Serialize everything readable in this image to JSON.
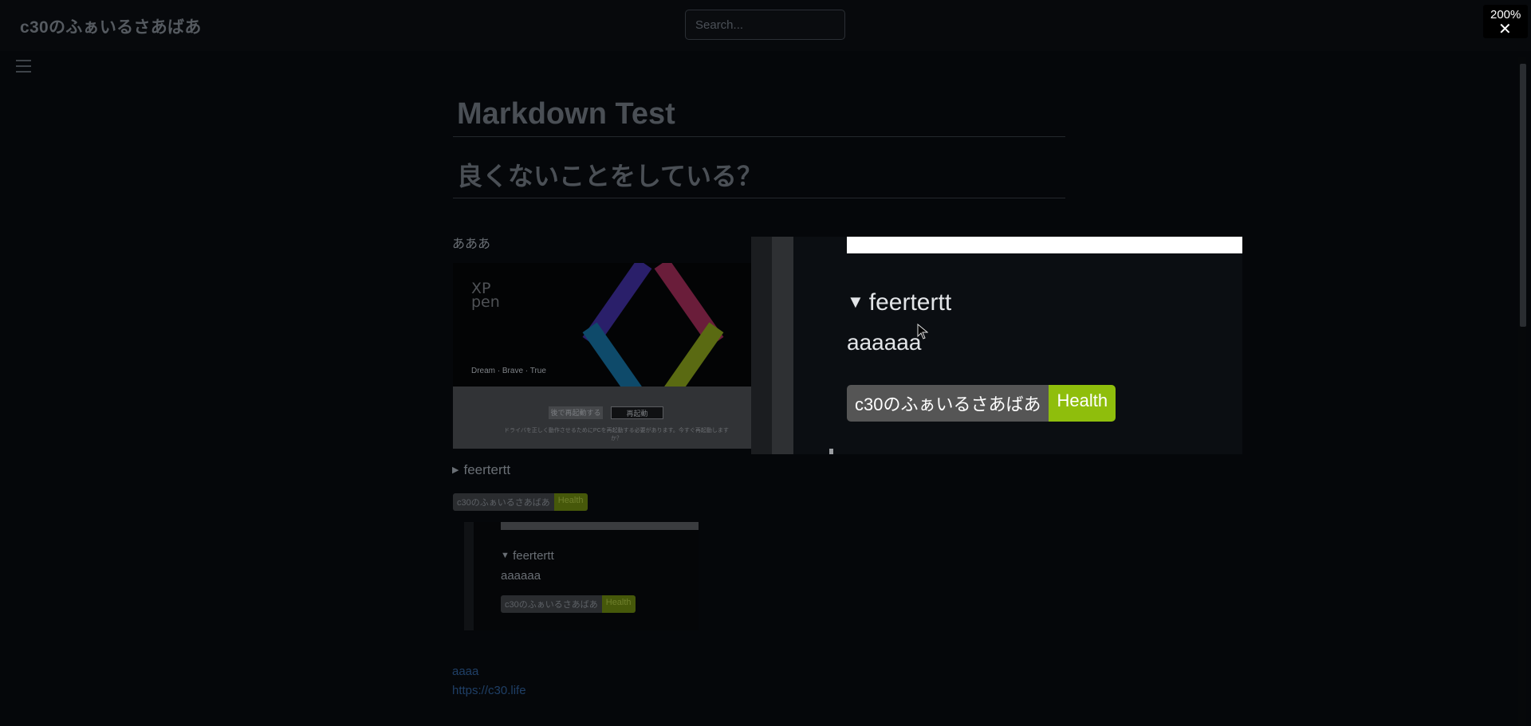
{
  "header": {
    "site_title": "c30のふぁいるさあばあ",
    "search_placeholder": "Search..."
  },
  "article": {
    "title": "Markdown Test",
    "heading2": "良くないことをしている？",
    "paragraph": "あああ",
    "screenshot": {
      "logo_line1": "XP",
      "logo_line2": "pen",
      "tagline": "Dream · Brave · True",
      "button_a": "後で再起動する",
      "button_b": "再起動",
      "note": "ドライバを正しく動作させるためにPCを再起動する必要があります。今すぐ再起動しますか？"
    },
    "details_summary": "feertertt",
    "badge": {
      "left": "c30のふぁいるさあばあ",
      "right": "Health"
    },
    "nested": {
      "summary": "feertertt",
      "body": "aaaaaa",
      "badge_left": "c30のふぁいるさあばあ",
      "badge_right": "Health"
    },
    "link1": "aaaa",
    "link2": "https://c30.life"
  },
  "zoom_view": {
    "summary": "feertertt",
    "body": "aaaaaa",
    "badge_left": "c30のふぁいるさあばあ",
    "badge_right": "Health",
    "triangle": "▼"
  },
  "zoom_control": {
    "level": "200%",
    "close": "✕"
  },
  "colors": {
    "health_badge": "#8fbe0c",
    "badge_label": "#555555",
    "background": "#05070a"
  },
  "icons": [
    "menu-icon",
    "close-icon",
    "triangle-down-icon",
    "triangle-right-icon",
    "mouse-cursor-icon"
  ]
}
